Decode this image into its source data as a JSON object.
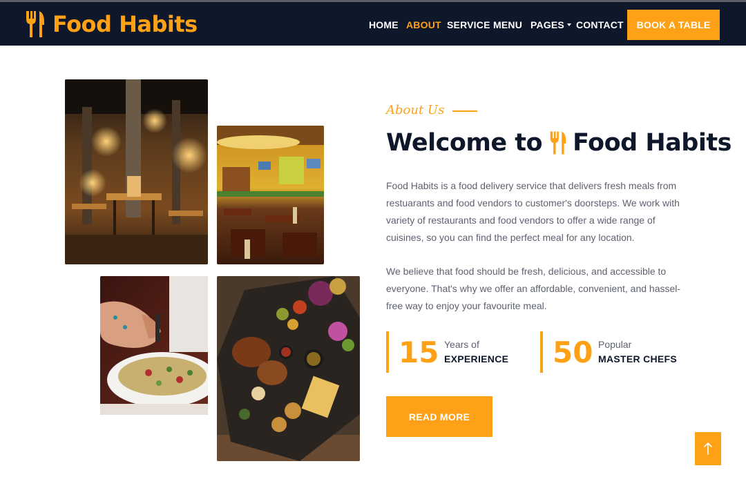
{
  "brand": {
    "name": "Food Habits",
    "icon": "utensils-icon",
    "color": "#fea116"
  },
  "nav": {
    "items": [
      {
        "label": "HOME",
        "active": false
      },
      {
        "label": "ABOUT",
        "active": true
      },
      {
        "label": "SERVICE",
        "active": false
      },
      {
        "label": "MENU",
        "active": false
      },
      {
        "label": "PAGES",
        "active": false,
        "dropdown": true
      },
      {
        "label": "CONTACT",
        "active": false
      }
    ],
    "cta": "BOOK A TABLE"
  },
  "about": {
    "tag": "About Us",
    "title_prefix": "Welcome to",
    "title_brand": "Food Habits",
    "paragraph1": "Food Habits is a food delivery service that delivers fresh meals from restuarants and food vendors to customer's doorsteps. We work with variety of restaurants and food vendors to offer a wide range of cuisines, so you can find the perfect meal for any location.",
    "paragraph2": "We believe that food should be fresh, delicious, and accessible to everyone. That's why we offer an affordable, convenient, and hassel-free way to enjoy your favourite meal.",
    "stats": [
      {
        "number": "15",
        "top": "Years of",
        "bottom": "EXPERIENCE"
      },
      {
        "number": "50",
        "top": "Popular",
        "bottom": "MASTER CHEFS"
      }
    ],
    "read_more": "READ MORE"
  },
  "images": [
    {
      "name": "restaurant-interior-photo"
    },
    {
      "name": "dining-room-photo"
    },
    {
      "name": "salad-plate-photo"
    },
    {
      "name": "food-platter-photo"
    }
  ],
  "back_to_top": {
    "icon": "arrow-up-icon"
  },
  "colors": {
    "primary": "#fea116",
    "dark": "#0f172b",
    "text": "#5e6170"
  }
}
